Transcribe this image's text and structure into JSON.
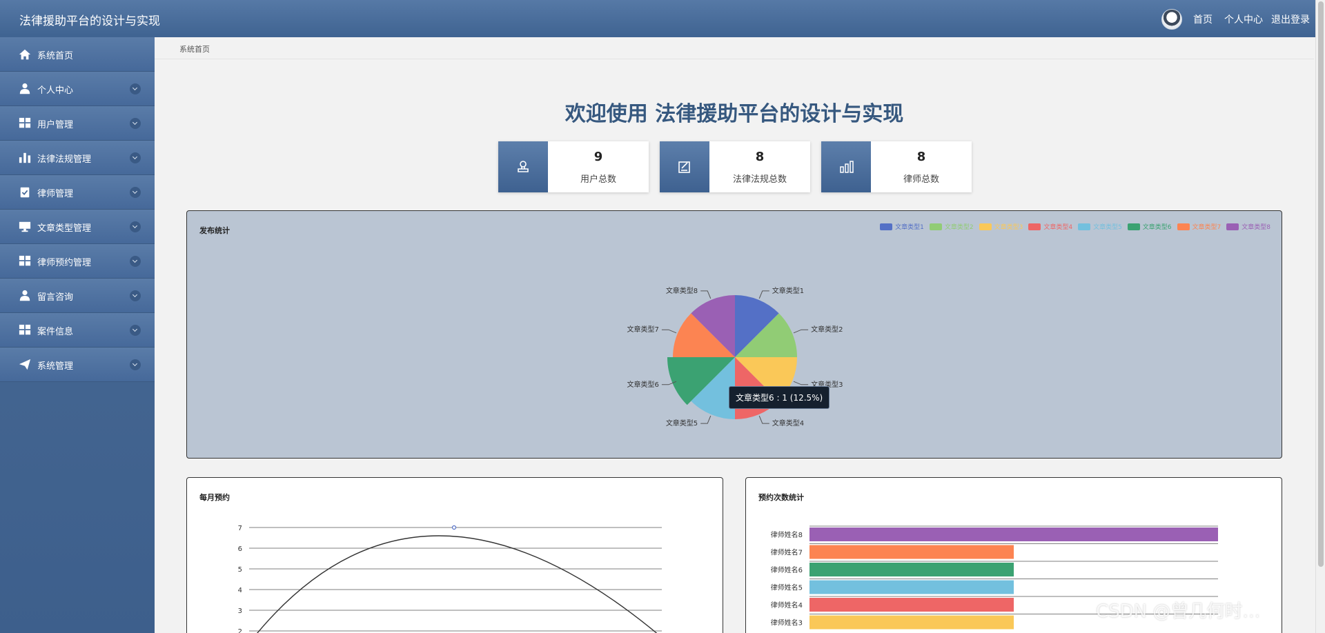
{
  "header": {
    "title": "法律援助平台的设计与实现",
    "links": [
      "首页",
      "个人中心",
      "退出登录"
    ]
  },
  "sidebar": {
    "items": [
      {
        "label": "系统首页",
        "icon": "home-icon"
      },
      {
        "label": "个人中心",
        "icon": "user-icon"
      },
      {
        "label": "用户管理",
        "icon": "grid-icon"
      },
      {
        "label": "法律法规管理",
        "icon": "bar-chart-icon"
      },
      {
        "label": "律师管理",
        "icon": "clipboard-icon"
      },
      {
        "label": "文章类型管理",
        "icon": "monitor-icon"
      },
      {
        "label": "律师预约管理",
        "icon": "grid-icon"
      },
      {
        "label": "留言咨询",
        "icon": "user-icon"
      },
      {
        "label": "案件信息",
        "icon": "grid-icon"
      },
      {
        "label": "系统管理",
        "icon": "send-icon"
      }
    ]
  },
  "breadcrumb": "系统首页",
  "welcome": "欢迎使用 法律援助平台的设计与实现",
  "stats": [
    {
      "value": "9",
      "label": "用户总数",
      "icon": "user-stamp-icon"
    },
    {
      "value": "8",
      "label": "法律法规总数",
      "icon": "edit-icon"
    },
    {
      "value": "8",
      "label": "律师总数",
      "icon": "bar-chart-icon"
    }
  ],
  "pie_panel": {
    "title": "发布统计",
    "tooltip": "文章类型6 : 1 (12.5%)"
  },
  "line_panel": {
    "title": "每月预约"
  },
  "bar_panel": {
    "title": "预约次数统计"
  },
  "colors": {
    "primary": "#3f6391",
    "series": [
      "#5470c6",
      "#91cc75",
      "#fac858",
      "#ee6666",
      "#73c0de",
      "#3ba272",
      "#fc8452",
      "#9a60b4"
    ]
  },
  "watermark": "CSDN @曾几何时…",
  "chart_data": [
    {
      "type": "pie",
      "title": "发布统计",
      "categories": [
        "文章类型1",
        "文章类型2",
        "文章类型3",
        "文章类型4",
        "文章类型5",
        "文章类型6",
        "文章类型7",
        "文章类型8"
      ],
      "values": [
        1,
        1,
        1,
        1,
        1,
        1,
        1,
        1
      ],
      "legend": "top-right"
    },
    {
      "type": "line",
      "title": "每月预约",
      "ylim": [
        2,
        7
      ],
      "yticks": [
        2,
        3,
        4,
        5,
        6,
        7
      ],
      "x": [
        0,
        1,
        2
      ],
      "values": [
        2,
        7,
        2
      ]
    },
    {
      "type": "bar",
      "title": "预约次数统计",
      "categories": [
        "律师姓名8",
        "律师姓名7",
        "律师姓名6",
        "律师姓名5",
        "律师姓名4",
        "律师姓名3"
      ],
      "values": [
        2,
        1,
        1,
        1,
        1,
        1
      ],
      "xlim": [
        0,
        2
      ]
    }
  ]
}
